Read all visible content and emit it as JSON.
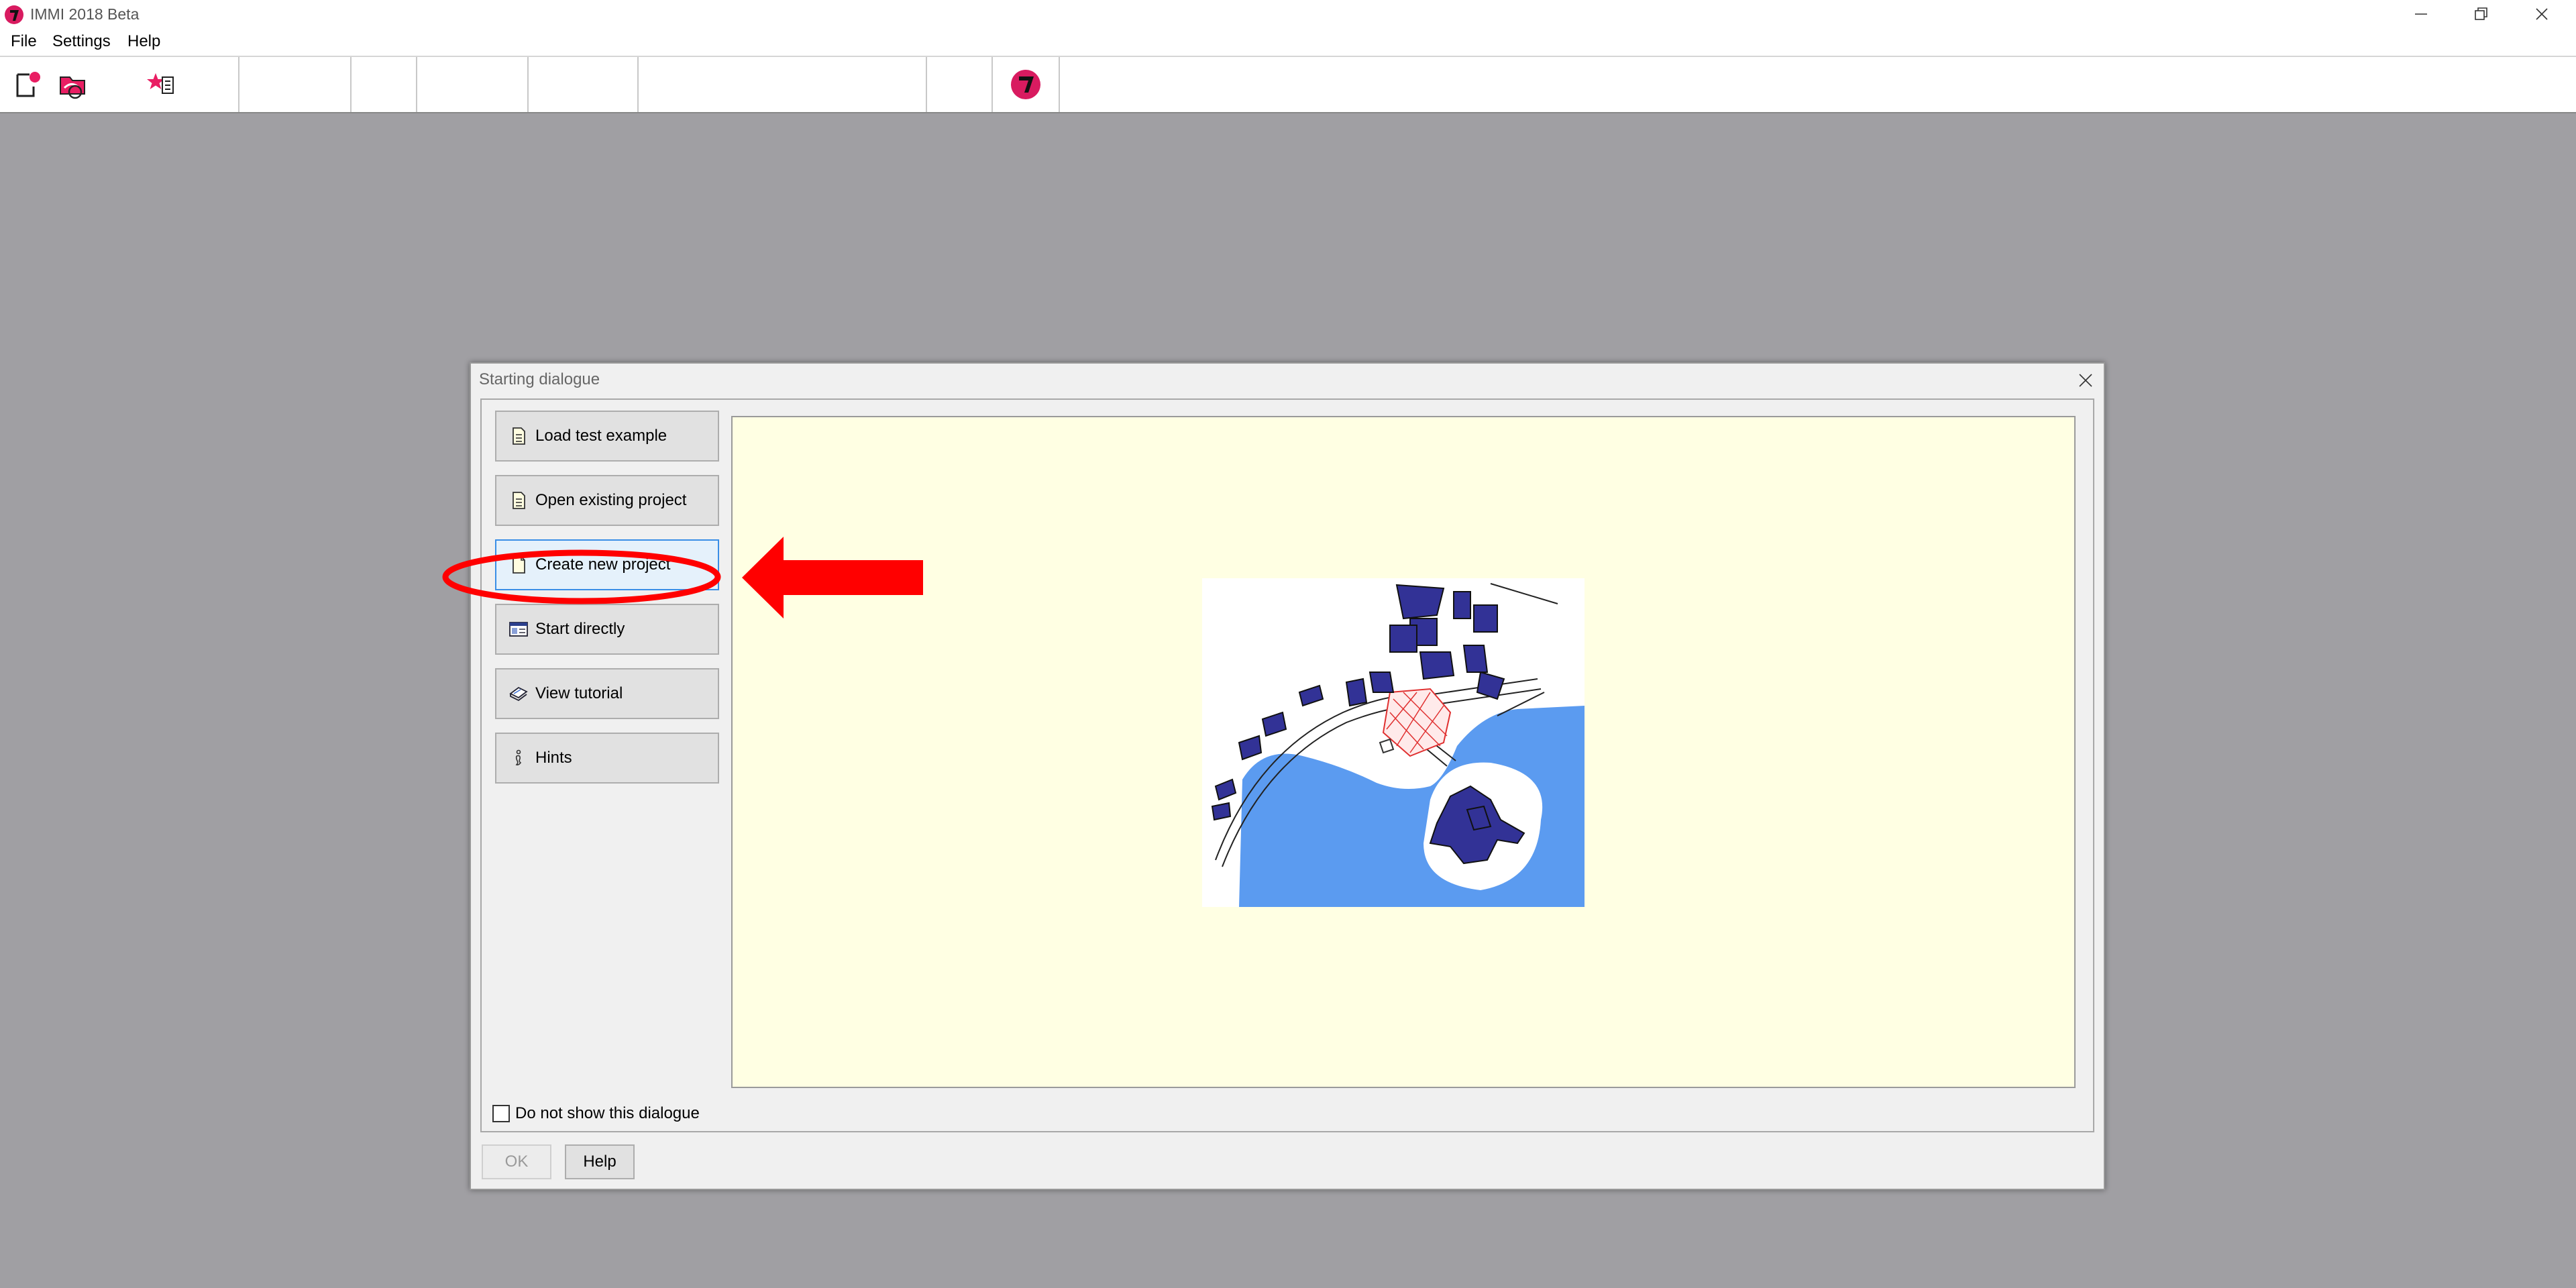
{
  "window": {
    "title": "IMMI 2018 Beta",
    "controls": [
      "minimize",
      "restore",
      "close"
    ]
  },
  "menubar": {
    "items": [
      "File",
      "Settings",
      "Help"
    ]
  },
  "toolbar": {
    "icons": [
      "new-project-icon",
      "open-project-icon",
      "favorites-icon",
      "immi-logo-icon"
    ]
  },
  "dialog": {
    "title": "Starting dialogue",
    "buttons": [
      {
        "label": "Load test example",
        "icon": "document-icon"
      },
      {
        "label": "Open existing project",
        "icon": "document-icon"
      },
      {
        "label": "Create new project",
        "icon": "blank-page-icon"
      },
      {
        "label": "Start directly",
        "icon": "window-icon"
      },
      {
        "label": "View tutorial",
        "icon": "book-icon"
      },
      {
        "label": "Hints",
        "icon": "info-icon"
      }
    ],
    "checkbox_label": "Do not show this dialogue",
    "checkbox_checked": false,
    "ok_label": "OK",
    "help_label": "Help"
  },
  "colors": {
    "workspace": "#a09fa3",
    "preview_background": "#ffffe3",
    "annotation": "#ff0000",
    "brand": "#d81b60"
  }
}
